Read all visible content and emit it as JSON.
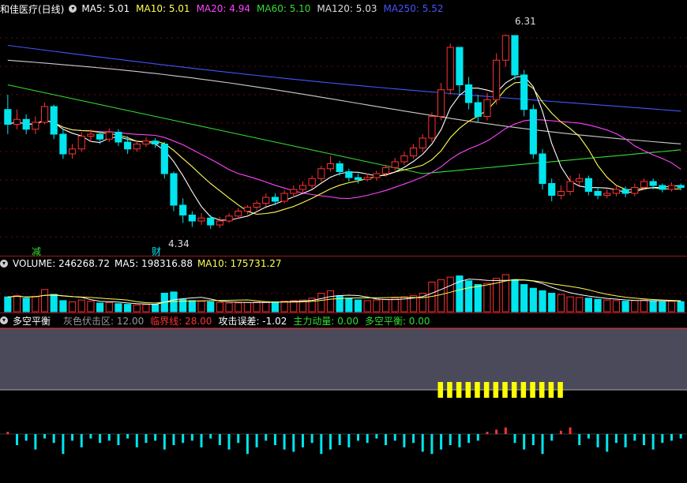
{
  "header": {
    "stock_name": "和佳医疗(日线)",
    "ma": [
      {
        "label": "MA5: 5.01",
        "color": "#ffffff"
      },
      {
        "label": "MA10: 5.01",
        "color": "#ffff55"
      },
      {
        "label": "MA20: 4.94",
        "color": "#ff44ff"
      },
      {
        "label": "MA60: 5.10",
        "color": "#33dd33"
      },
      {
        "label": "MA120: 5.03",
        "color": "#dddddd"
      },
      {
        "label": "MA250: 5.52",
        "color": "#4455ff"
      }
    ]
  },
  "price_chart": {
    "high_label": "6.31",
    "low_label": "4.34",
    "marker_jian": "减",
    "marker_cai": "财",
    "ylim": [
      4.1,
      6.5
    ]
  },
  "volume_panel": {
    "label": "VOLUME: 246268.72",
    "ma5": "MA5: 198316.88",
    "ma10": "MA10: 175731.27"
  },
  "indicator_panel": {
    "name": "多空平衡",
    "items": [
      {
        "label": "灰色伏击区: 12.00",
        "color": "#999999"
      },
      {
        "label": "临界线: 28.00",
        "color": "#ff3333"
      },
      {
        "label": "攻击误差: -1.02",
        "color": "#ffffff"
      },
      {
        "label": "主力动量: 0.00",
        "color": "#33dd33"
      },
      {
        "label": "多空平衡: 0.00",
        "color": "#33dd33"
      }
    ]
  },
  "colors": {
    "up": "#ff3232",
    "down": "#00e5ee",
    "zone": "#4a4a5a",
    "yellow": "#ffff00",
    "ma5": "#ffffff",
    "ma10": "#ffff55",
    "ma20": "#ff44ff",
    "ma60": "#33dd33",
    "ma120": "#cccccc",
    "ma250": "#4455ff"
  },
  "chart_data": {
    "type": "candlestick",
    "candles": [
      [
        5.55,
        5.4,
        5.7,
        5.3
      ],
      [
        5.4,
        5.45,
        5.55,
        5.35
      ],
      [
        5.45,
        5.35,
        5.5,
        5.3
      ],
      [
        5.35,
        5.42,
        5.48,
        5.3
      ],
      [
        5.42,
        5.58,
        5.62,
        5.4
      ],
      [
        5.58,
        5.3,
        5.6,
        5.25
      ],
      [
        5.3,
        5.1,
        5.35,
        5.05
      ],
      [
        5.1,
        5.15,
        5.2,
        5.05
      ],
      [
        5.15,
        5.28,
        5.32,
        5.12
      ],
      [
        5.28,
        5.3,
        5.35,
        5.22
      ],
      [
        5.3,
        5.25,
        5.33,
        5.2
      ],
      [
        5.25,
        5.32,
        5.36,
        5.22
      ],
      [
        5.32,
        5.22,
        5.35,
        5.18
      ],
      [
        5.22,
        5.15,
        5.28,
        5.1
      ],
      [
        5.15,
        5.2,
        5.24,
        5.12
      ],
      [
        5.2,
        5.23,
        5.27,
        5.17
      ],
      [
        5.23,
        5.2,
        5.26,
        5.16
      ],
      [
        5.2,
        4.9,
        5.22,
        4.85
      ],
      [
        4.9,
        4.58,
        4.92,
        4.52
      ],
      [
        4.58,
        4.48,
        4.65,
        4.4
      ],
      [
        4.48,
        4.42,
        4.52,
        4.36
      ],
      [
        4.42,
        4.45,
        4.5,
        4.38
      ],
      [
        4.45,
        4.38,
        4.48,
        4.34
      ],
      [
        4.38,
        4.42,
        4.46,
        4.35
      ],
      [
        4.42,
        4.47,
        4.5,
        4.4
      ],
      [
        4.47,
        4.52,
        4.55,
        4.44
      ],
      [
        4.52,
        4.56,
        4.58,
        4.49
      ],
      [
        4.56,
        4.6,
        4.63,
        4.53
      ],
      [
        4.6,
        4.66,
        4.7,
        4.57
      ],
      [
        4.66,
        4.62,
        4.7,
        4.58
      ],
      [
        4.62,
        4.7,
        4.73,
        4.6
      ],
      [
        4.7,
        4.74,
        4.78,
        4.66
      ],
      [
        4.74,
        4.78,
        4.82,
        4.7
      ],
      [
        4.78,
        4.85,
        4.88,
        4.74
      ],
      [
        4.85,
        4.95,
        4.98,
        4.82
      ],
      [
        4.95,
        5.0,
        5.08,
        4.92
      ],
      [
        5.0,
        4.92,
        5.03,
        4.88
      ],
      [
        4.92,
        4.86,
        4.95,
        4.82
      ],
      [
        4.86,
        4.84,
        4.9,
        4.8
      ],
      [
        4.84,
        4.86,
        4.9,
        4.82
      ],
      [
        4.86,
        4.9,
        4.93,
        4.83
      ],
      [
        4.9,
        4.96,
        4.99,
        4.87
      ],
      [
        4.96,
        5.02,
        5.06,
        4.93
      ],
      [
        5.02,
        5.08,
        5.12,
        4.99
      ],
      [
        5.08,
        5.16,
        5.2,
        5.05
      ],
      [
        5.16,
        5.26,
        5.3,
        5.12
      ],
      [
        5.26,
        5.48,
        5.52,
        5.22
      ],
      [
        5.48,
        5.75,
        5.82,
        5.44
      ],
      [
        5.75,
        6.18,
        6.22,
        5.7
      ],
      [
        6.18,
        5.8,
        6.18,
        5.7
      ],
      [
        5.8,
        5.62,
        5.88,
        5.55
      ],
      [
        5.62,
        5.48,
        5.7,
        5.42
      ],
      [
        5.48,
        5.65,
        5.72,
        5.44
      ],
      [
        5.65,
        6.05,
        6.12,
        5.6
      ],
      [
        6.05,
        6.3,
        6.31,
        5.98
      ],
      [
        6.3,
        5.9,
        6.3,
        5.85
      ],
      [
        5.9,
        5.55,
        5.95,
        5.48
      ],
      [
        5.55,
        5.1,
        5.6,
        5.05
      ],
      [
        5.1,
        4.8,
        5.15,
        4.74
      ],
      [
        4.8,
        4.68,
        4.85,
        4.62
      ],
      [
        4.68,
        4.72,
        4.78,
        4.64
      ],
      [
        4.72,
        4.82,
        4.88,
        4.68
      ],
      [
        4.82,
        4.85,
        4.9,
        4.78
      ],
      [
        4.85,
        4.72,
        4.88,
        4.68
      ],
      [
        4.72,
        4.68,
        4.76,
        4.64
      ],
      [
        4.68,
        4.7,
        4.74,
        4.65
      ],
      [
        4.7,
        4.74,
        4.78,
        4.67
      ],
      [
        4.74,
        4.7,
        4.77,
        4.66
      ],
      [
        4.7,
        4.76,
        4.8,
        4.67
      ],
      [
        4.76,
        4.82,
        4.85,
        4.73
      ],
      [
        4.82,
        4.78,
        4.85,
        4.74
      ],
      [
        4.78,
        4.74,
        4.8,
        4.71
      ],
      [
        4.74,
        4.78,
        4.81,
        4.72
      ],
      [
        4.78,
        4.76,
        4.8,
        4.73
      ]
    ],
    "volume": [
      120,
      130,
      110,
      125,
      180,
      140,
      90,
      80,
      95,
      85,
      70,
      75,
      65,
      60,
      55,
      58,
      60,
      150,
      160,
      100,
      90,
      85,
      80,
      75,
      70,
      72,
      75,
      78,
      82,
      80,
      85,
      90,
      95,
      110,
      150,
      170,
      130,
      110,
      95,
      90,
      95,
      100,
      110,
      120,
      130,
      150,
      240,
      260,
      280,
      290,
      250,
      220,
      230,
      270,
      300,
      260,
      220,
      190,
      170,
      150,
      140,
      120,
      115,
      110,
      100,
      95,
      90,
      85,
      90,
      95,
      88,
      80,
      85,
      82
    ],
    "indicator": [
      0.1,
      -0.5,
      -0.3,
      -0.7,
      -0.2,
      -0.4,
      -0.9,
      -0.3,
      -0.6,
      -0.2,
      -0.4,
      -0.3,
      -0.5,
      -0.2,
      -0.6,
      -0.4,
      -0.3,
      -0.7,
      -0.5,
      -0.4,
      -0.3,
      -0.6,
      -0.2,
      -0.5,
      -0.7,
      -0.4,
      -0.9,
      -0.6,
      -0.3,
      -0.5,
      -0.7,
      -0.8,
      -0.6,
      -0.4,
      -0.9,
      -0.7,
      -0.5,
      -0.6,
      -0.3,
      -0.4,
      -0.2,
      -0.5,
      -0.3,
      -0.6,
      -0.4,
      -0.8,
      -0.9,
      -0.7,
      -0.5,
      -0.6,
      -0.4,
      -0.3,
      0.1,
      0.2,
      0.3,
      -0.4,
      -0.7,
      -0.5,
      -0.9,
      -0.3,
      0.15,
      0.3,
      -0.5,
      -0.2,
      -0.6,
      -0.8,
      -0.4,
      -0.6,
      -0.3,
      -0.5,
      -0.7,
      -0.4,
      -0.3,
      -0.2
    ],
    "yellow_segment": [
      47,
      60
    ]
  }
}
